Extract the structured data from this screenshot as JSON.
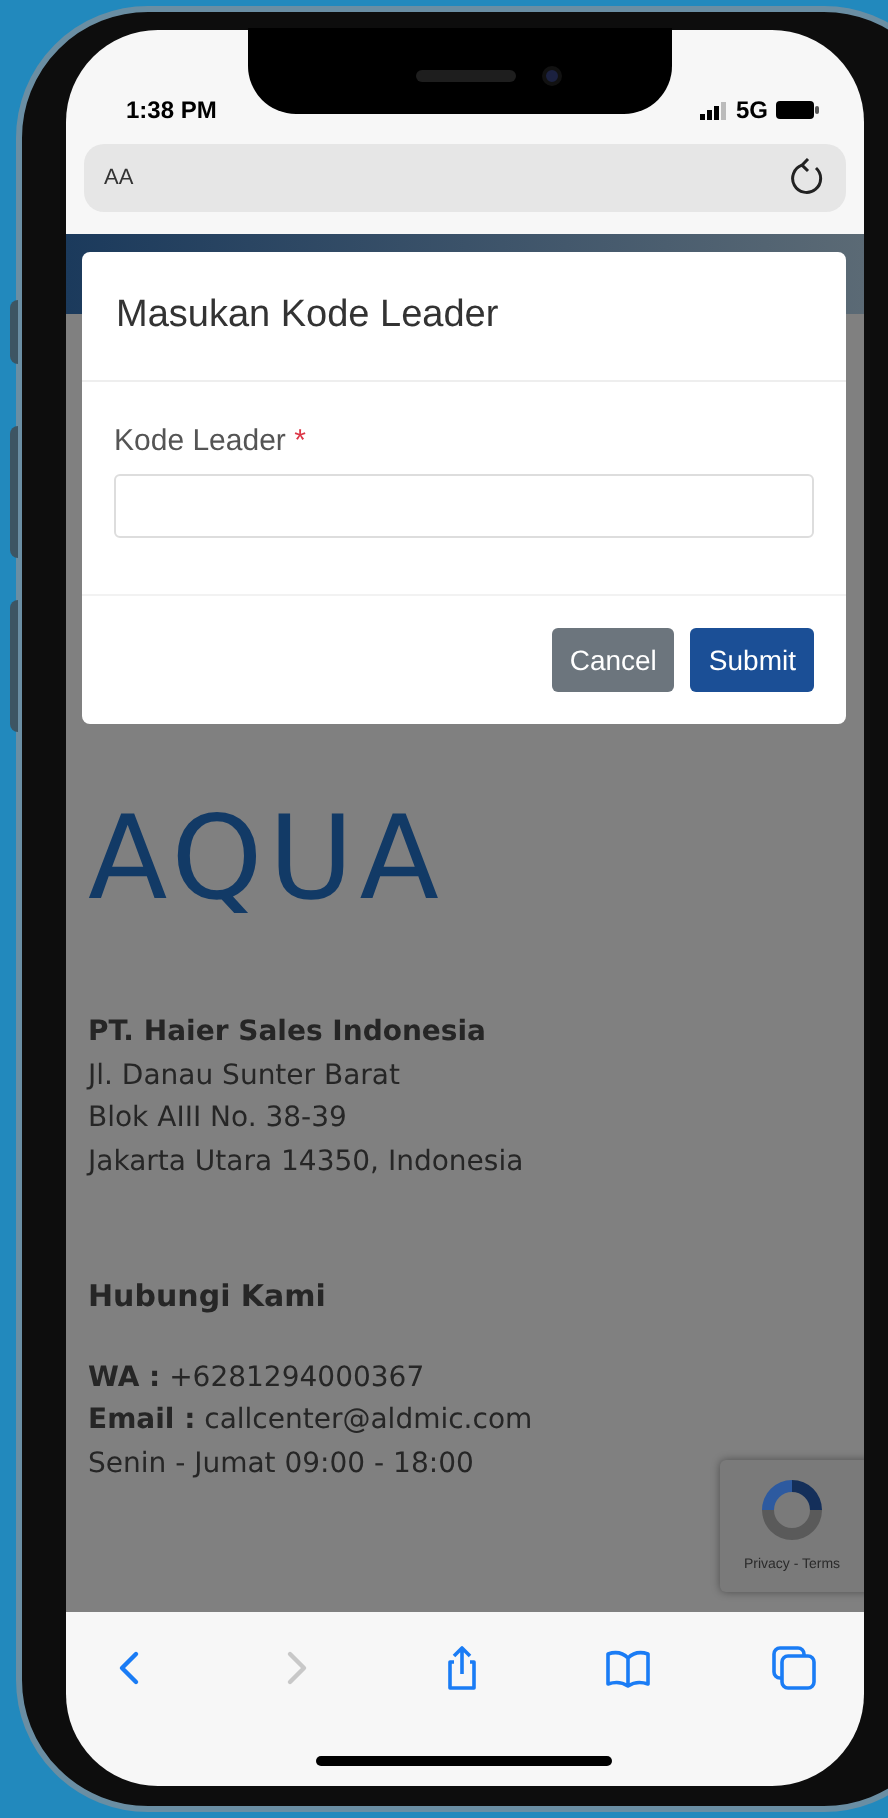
{
  "status_bar": {
    "time": "1:38 PM",
    "network": "5G"
  },
  "address_bar": {
    "text_size_button": "AA"
  },
  "dialog": {
    "title": "Masukan Kode Leader",
    "field": {
      "label": "Kode Leader",
      "required_mark": "*"
    },
    "buttons": [
      {
        "label": "Cancel",
        "kind": "secondary"
      },
      {
        "label": "Submit",
        "kind": "primary"
      }
    ]
  },
  "footer": {
    "logo": "AQUA",
    "company": "PT. Haier Sales Indonesia",
    "address_lines": [
      "Jl. Danau Sunter Barat",
      "Blok AIII No. 38-39",
      "Jakarta Utara 14350, Indonesia"
    ],
    "contact_heading": "Hubungi Kami",
    "contacts": [
      {
        "label": "WA :",
        "value": "+6281294000367"
      },
      {
        "label": "Email :",
        "value": "callcenter@aldmic.com"
      }
    ],
    "hours": "Senin - Jumat 09:00 - 18:00"
  },
  "recaptcha": {
    "links": "Privacy - Terms"
  },
  "toolbar": [
    {
      "kind": "back",
      "disabled": false
    },
    {
      "kind": "forward",
      "disabled": true
    },
    {
      "kind": "share",
      "disabled": false
    },
    {
      "kind": "bookmarks",
      "disabled": false
    },
    {
      "kind": "tabs",
      "disabled": false
    }
  ]
}
